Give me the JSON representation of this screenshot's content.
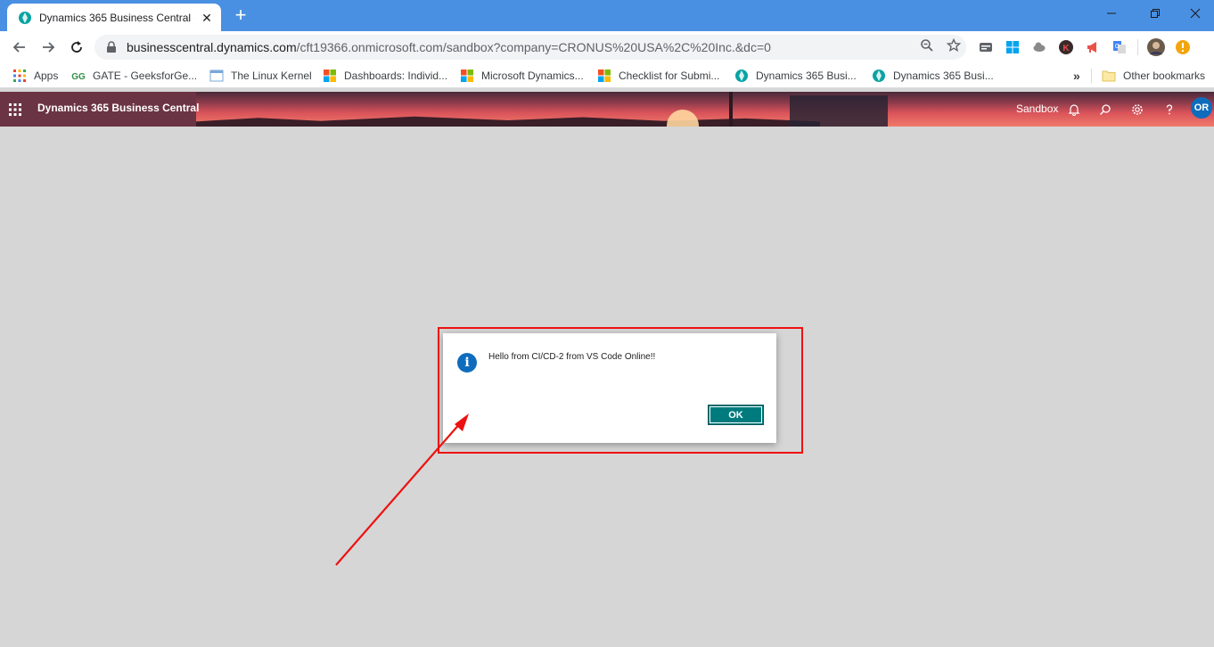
{
  "browser": {
    "tab_title": "Dynamics 365 Business Central -",
    "close_label": "✕",
    "new_tab_label": "+",
    "url_host": "businesscentral.dynamics.com",
    "url_path": "/cft19366.onmicrosoft.com/sandbox?company=CRONUS%20USA%2C%20Inc.&dc=0",
    "profile_initial": "K",
    "chrome_color": "#4a90e2"
  },
  "bookmarks": {
    "items": [
      {
        "label": "Apps",
        "icon": "apps-grid-icon"
      },
      {
        "label": "GATE - GeeksforGe...",
        "icon": "geeksforgeeks-icon"
      },
      {
        "label": "The Linux Kernel",
        "icon": "kernel-icon"
      },
      {
        "label": "Dashboards: Individ...",
        "icon": "microsoft-icon"
      },
      {
        "label": "Microsoft Dynamics...",
        "icon": "microsoft-icon"
      },
      {
        "label": "Checklist for Submi...",
        "icon": "microsoft-icon"
      },
      {
        "label": "Dynamics 365 Busi...",
        "icon": "dynamics-icon"
      },
      {
        "label": "Dynamics 365 Busi...",
        "icon": "dynamics-icon"
      }
    ],
    "more": "»",
    "other": "Other bookmarks"
  },
  "appbar": {
    "title": "Dynamics 365 Business Central",
    "environment": "Sandbox",
    "avatar": "OR"
  },
  "dialog": {
    "message": "Hello from CI/CD-2 from VS Code Online!!",
    "icon_glyph": "i",
    "ok_label": "OK",
    "accent": "#007b7d"
  },
  "annotation": {
    "color": "#ee1111"
  }
}
